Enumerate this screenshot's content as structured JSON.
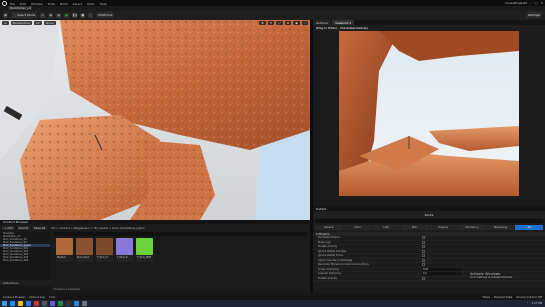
{
  "window": {
    "menu": [
      "File",
      "Edit",
      "Window",
      "Tools",
      "Build",
      "Select",
      "Actor",
      "Help"
    ],
    "project_tab": "Rockfolder_Lit",
    "user": "UnrealEngine5"
  },
  "toolbar": {
    "mode_label": "Select Mode",
    "platforms_label": "Platforms",
    "settings_label": "Settings"
  },
  "viewport_left": {
    "view_label": "Perspective",
    "lit_label": "Lit",
    "show_label": "Show"
  },
  "right_panel": {
    "tabs": [
      "Outliner",
      "Viewport 2"
    ],
    "pie_label": "[Play In Editor - Client/standalone]"
  },
  "details": {
    "header": "Details",
    "title": "Rocks",
    "tabs": [
      "General",
      "Actor",
      "LOD",
      "Misc",
      "Physics",
      "Rendering",
      "Streaming",
      "All"
    ],
    "active_tab": "All",
    "section": "Physics",
    "rows": [
      {
        "label": "Simulate Physics",
        "kind": "check"
      },
      {
        "label": "Mass (kg)",
        "kind": "check"
      },
      {
        "label": "Enable Gravity",
        "kind": "check"
      },
      {
        "label": "Ignore Radial Impulse",
        "kind": "check"
      },
      {
        "label": "Ignore Radial Force",
        "kind": "check"
      },
      {
        "label": "Apply Impulse on Damage",
        "kind": "check"
      },
      {
        "label": "Replicate Physics to Autonomous Proxy",
        "kind": "check"
      },
      {
        "label": "Linear Damping",
        "kind": "value",
        "value": "0.01"
      },
      {
        "label": "Angular Damping",
        "kind": "value",
        "value": "0.0"
      },
      {
        "label": "Enable Gravity",
        "kind": "check"
      }
    ]
  },
  "content_browser": {
    "header": "Content Browser",
    "add_label": "Add",
    "import_label": "Import",
    "save_label": "Save All",
    "breadcrumb": "All > Content > Megascans > 3D_Assets > Rock_Sandstone_Lgvcz",
    "tree": [
      "Favorites",
      "Rockfolder_Lit",
      "Rock_Sandstone_01",
      "Rock_Sandstone_02",
      "Rock_Sandstone_Lgvcz",
      "Rock_Sandstone_S02",
      "Rock_Sandstone_S03",
      "Rock_Sandstone_S04",
      "Rock_Sandstone_S05",
      "Rock_Sandstone_S06"
    ],
    "selected_tree": 4,
    "assets": [
      {
        "name": "MI_Rock",
        "color": "#b06a3a"
      },
      {
        "name": "Rock_Sand",
        "color": "#8a5230"
      },
      {
        "name": "T_Rock_D",
        "color": "#7a4a2a"
      },
      {
        "name": "T_Rock_N",
        "color": "#8a78d8"
      },
      {
        "name": "T_Rock_ORM",
        "color": "#6ad23a"
      }
    ],
    "footer": "5 items (1 selected)",
    "collections": "Collections"
  },
  "status": {
    "items": [
      "Content Drawer",
      "Output Log",
      "Cmd"
    ],
    "right": [
      "Trace",
      "Derived Data",
      "Source Control Off"
    ]
  },
  "activate": {
    "line1": "Activate Windows",
    "line2": "Go to Settings to activate Windows."
  },
  "taskbar": {
    "time": "1:17 PM",
    "icons": [
      "#1e90ff",
      "#f0c020",
      "#2a7de1",
      "#d13438",
      "#555",
      "#6b5bd6",
      "#1a8f3a",
      "#333",
      "#2b88d8",
      "#777"
    ]
  }
}
